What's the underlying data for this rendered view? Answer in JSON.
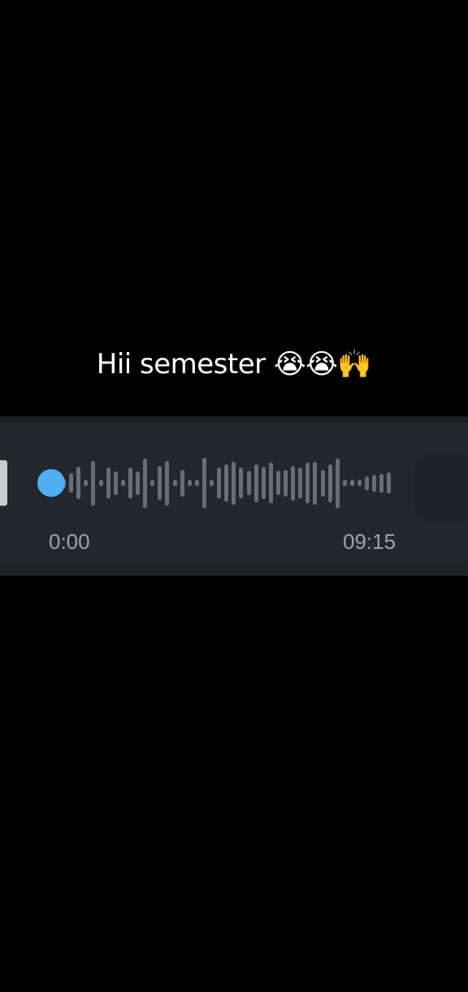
{
  "caption": {
    "text": "Hii semester 😭😭🙌"
  },
  "voice_message": {
    "current_time": "0:00",
    "duration": "09:15",
    "progress": 0,
    "accent_color": "#4fb0f2",
    "waveform_color": "#6a6e74",
    "icons": {
      "play": "play-icon"
    },
    "waveform_levels": [
      0.15,
      0.32,
      0.52,
      0.1,
      0.72,
      0.1,
      0.5,
      0.38,
      0.1,
      0.5,
      0.38,
      0.8,
      0.1,
      0.55,
      0.72,
      0.1,
      0.44,
      0.1,
      0.1,
      0.82,
      0.1,
      0.5,
      0.6,
      0.7,
      0.5,
      0.4,
      0.62,
      0.52,
      0.66,
      0.4,
      0.44,
      0.56,
      0.5,
      0.66,
      0.7,
      0.44,
      0.62,
      0.8,
      0.1,
      0.1,
      0.1,
      0.22,
      0.28,
      0.3,
      0.34
    ]
  }
}
